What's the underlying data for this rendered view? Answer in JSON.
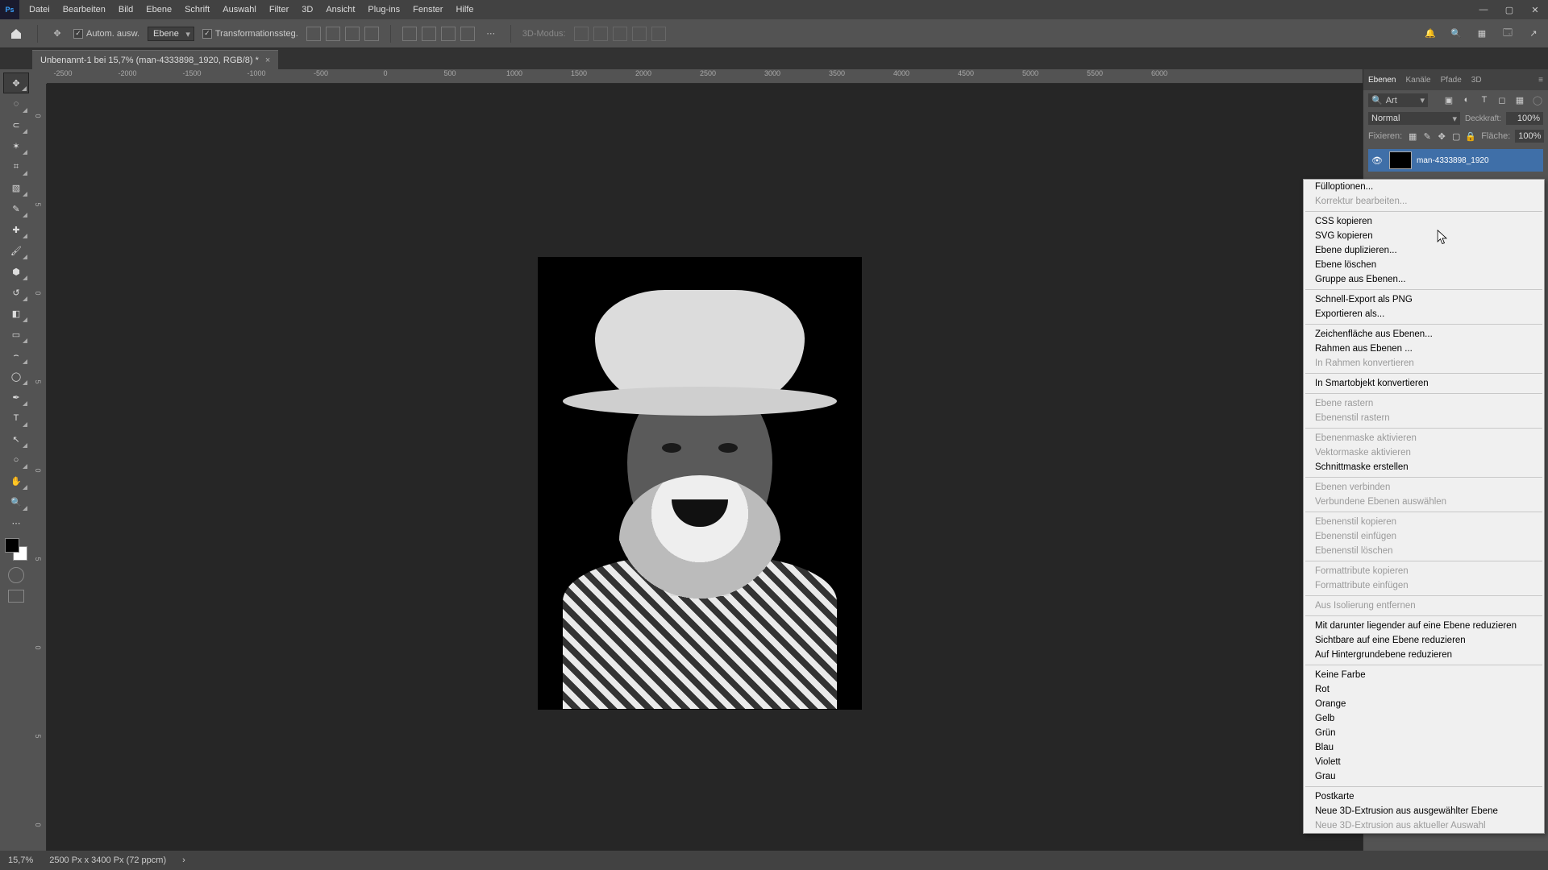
{
  "window": {
    "title": "Ps"
  },
  "menu": [
    "Datei",
    "Bearbeiten",
    "Bild",
    "Ebene",
    "Schrift",
    "Auswahl",
    "Filter",
    "3D",
    "Ansicht",
    "Plug-ins",
    "Fenster",
    "Hilfe"
  ],
  "options": {
    "auto_select_label": "Autom. ausw.",
    "auto_select_target": "Ebene",
    "transform_label": "Transformationssteg.",
    "mode3d_label": "3D-Modus:"
  },
  "right_tools": [
    "🔔",
    "🔍",
    "▦",
    "🗔",
    "↗"
  ],
  "doc_tab": {
    "title": "Unbenannt-1 bei 15,7% (man-4333898_1920, RGB/8) *"
  },
  "ruler_h": [
    "-2500",
    "-2000",
    "-1500",
    "-1000",
    "-500",
    "0",
    "500",
    "1000",
    "1500",
    "2000",
    "2500",
    "3000",
    "3500",
    "4000",
    "4500",
    "5000",
    "5500",
    "6000"
  ],
  "ruler_v": [
    "0",
    "5",
    "0",
    "5",
    "0",
    "5",
    "0",
    "5",
    "0"
  ],
  "panel": {
    "tabs": [
      "Ebenen",
      "Kanäle",
      "Pfade",
      "3D"
    ],
    "search_label": "Art",
    "blend_mode": "Normal",
    "opacity_label": "Deckkraft:",
    "opacity_value": "100%",
    "lock_label": "Fixieren:",
    "fill_label": "Fläche:",
    "fill_value": "100%",
    "layer_name": "man-4333898_1920"
  },
  "context_menu": [
    {
      "label": "Fülloptionen...",
      "disabled": false
    },
    {
      "label": "Korrektur bearbeiten...",
      "disabled": true
    },
    {
      "sep": true
    },
    {
      "label": "CSS kopieren",
      "disabled": false
    },
    {
      "label": "SVG kopieren",
      "disabled": false
    },
    {
      "label": "Ebene duplizieren...",
      "disabled": false
    },
    {
      "label": "Ebene löschen",
      "disabled": false
    },
    {
      "label": "Gruppe aus Ebenen...",
      "disabled": false
    },
    {
      "sep": true
    },
    {
      "label": "Schnell-Export als PNG",
      "disabled": false
    },
    {
      "label": "Exportieren als...",
      "disabled": false
    },
    {
      "sep": true
    },
    {
      "label": "Zeichenfläche aus Ebenen...",
      "disabled": false
    },
    {
      "label": "Rahmen aus Ebenen ...",
      "disabled": false
    },
    {
      "label": "In Rahmen konvertieren",
      "disabled": true
    },
    {
      "sep": true
    },
    {
      "label": "In Smartobjekt konvertieren",
      "disabled": false
    },
    {
      "sep": true
    },
    {
      "label": "Ebene rastern",
      "disabled": true
    },
    {
      "label": "Ebenenstil rastern",
      "disabled": true
    },
    {
      "sep": true
    },
    {
      "label": "Ebenenmaske aktivieren",
      "disabled": true
    },
    {
      "label": "Vektormaske aktivieren",
      "disabled": true
    },
    {
      "label": "Schnittmaske erstellen",
      "disabled": false
    },
    {
      "sep": true
    },
    {
      "label": "Ebenen verbinden",
      "disabled": true
    },
    {
      "label": "Verbundene Ebenen auswählen",
      "disabled": true
    },
    {
      "sep": true
    },
    {
      "label": "Ebenenstil kopieren",
      "disabled": true
    },
    {
      "label": "Ebenenstil einfügen",
      "disabled": true
    },
    {
      "label": "Ebenenstil löschen",
      "disabled": true
    },
    {
      "sep": true
    },
    {
      "label": "Formattribute kopieren",
      "disabled": true
    },
    {
      "label": "Formattribute einfügen",
      "disabled": true
    },
    {
      "sep": true
    },
    {
      "label": "Aus Isolierung entfernen",
      "disabled": true
    },
    {
      "sep": true
    },
    {
      "label": "Mit darunter liegender auf eine Ebene reduzieren",
      "disabled": false
    },
    {
      "label": "Sichtbare auf eine Ebene reduzieren",
      "disabled": false
    },
    {
      "label": "Auf Hintergrundebene reduzieren",
      "disabled": false
    },
    {
      "sep": true
    },
    {
      "label": "Keine Farbe",
      "disabled": false
    },
    {
      "label": "Rot",
      "disabled": false
    },
    {
      "label": "Orange",
      "disabled": false
    },
    {
      "label": "Gelb",
      "disabled": false
    },
    {
      "label": "Grün",
      "disabled": false
    },
    {
      "label": "Blau",
      "disabled": false
    },
    {
      "label": "Violett",
      "disabled": false
    },
    {
      "label": "Grau",
      "disabled": false
    },
    {
      "sep": true
    },
    {
      "label": "Postkarte",
      "disabled": false
    },
    {
      "label": "Neue 3D-Extrusion aus ausgewählter Ebene",
      "disabled": false
    },
    {
      "label": "Neue 3D-Extrusion aus aktueller Auswahl",
      "disabled": true
    }
  ],
  "status": {
    "zoom": "15,7%",
    "info": "2500 Px x 3400 Px (72 ppcm)"
  }
}
